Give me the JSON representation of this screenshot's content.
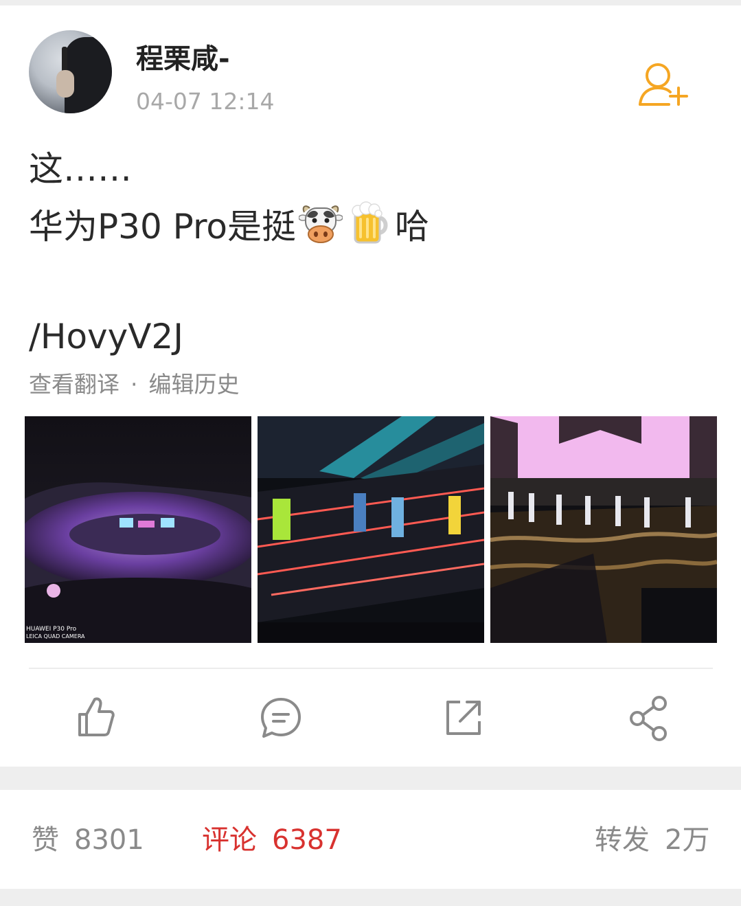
{
  "post": {
    "username": "程栗咸-",
    "timestamp": "04-07 12:14",
    "text_line1": "这……",
    "text_line2_before": "华为P30 Pro是挺",
    "text_line2_after": "哈",
    "emojis": [
      "cow-face-emoji",
      "beer-mug-emoji"
    ],
    "link": "/HovyV2J",
    "translate_label": "查看翻译",
    "separator": "·",
    "edit_history_label": "编辑历史",
    "photo_watermark_line1": "HUAWEI P30 Pro",
    "photo_watermark_line2": "LEICA QUAD CAMERA"
  },
  "actions": {
    "icons": [
      "thumbs-up-icon",
      "comment-icon",
      "repost-icon",
      "share-icon"
    ]
  },
  "stats": {
    "likes_label": "赞",
    "likes_count": "8301",
    "comments_label": "评论",
    "comments_count": "6387",
    "reposts_label": "转发",
    "reposts_count": "2万"
  },
  "colors": {
    "accent_orange": "#f5a623",
    "comment_red": "#d8322f",
    "muted_gray": "#8a8a8a"
  }
}
